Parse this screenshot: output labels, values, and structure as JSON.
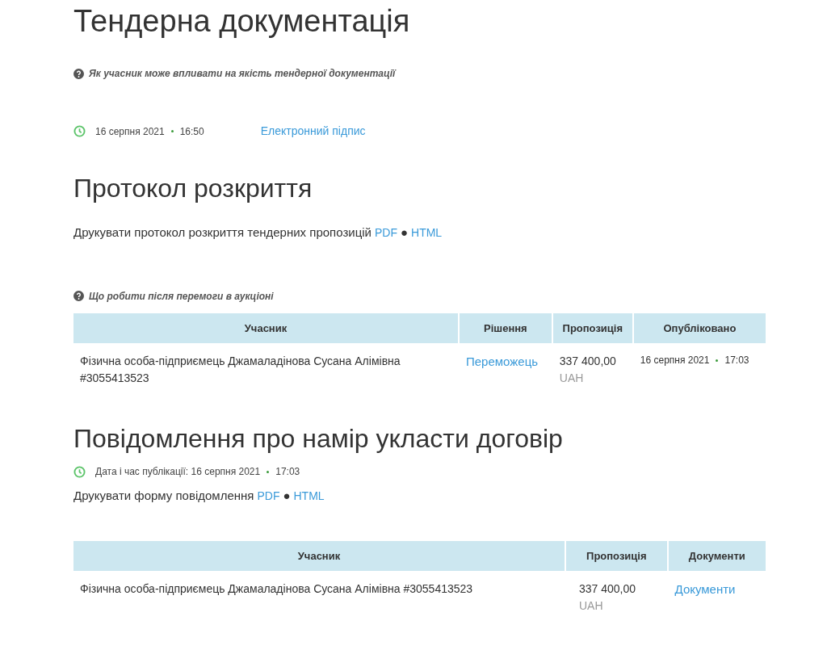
{
  "tender_docs": {
    "heading": "Тендерна документація",
    "help_link": "Як учасник може впливати на якість тендерної документації",
    "date": "16 серпня 2021",
    "time": "16:50",
    "signature_link": "Електронний підпис"
  },
  "opening_protocol": {
    "heading": "Протокол розкриття",
    "print_text": "Друкувати протокол розкриття тендерних пропозицій",
    "links": [
      "PDF",
      "HTML"
    ],
    "separator": "●"
  },
  "auction": {
    "help_link": "Що робити після перемоги в аукціоні",
    "columns": [
      "Учасник",
      "Рішення",
      "Пропозиція",
      "Опубліковано"
    ],
    "rows": [
      {
        "participant": "Фізична особа-підприємець Джамаладінова Сусана Алімівна #3055413523",
        "decision": "Переможець",
        "amount": "337 400,00",
        "currency": "UAH",
        "date": "16 серпня 2021",
        "time": "17:03"
      }
    ]
  },
  "intent_notice": {
    "heading": "Повідомлення про намір укласти договір",
    "published_label": "Дата і час публікації: 16 серпня 2021",
    "published_time": "17:03",
    "print_text": "Друкувати форму повідомлення",
    "links": [
      "PDF",
      "HTML"
    ],
    "separator": "●",
    "columns": [
      "Учасник",
      "Пропозиція",
      "Документи"
    ],
    "rows": [
      {
        "participant": "Фізична особа-підприємець Джамаладінова Сусана Алімівна #3055413523",
        "amount": "337 400,00",
        "currency": "UAH",
        "documents": "Документи"
      }
    ]
  }
}
